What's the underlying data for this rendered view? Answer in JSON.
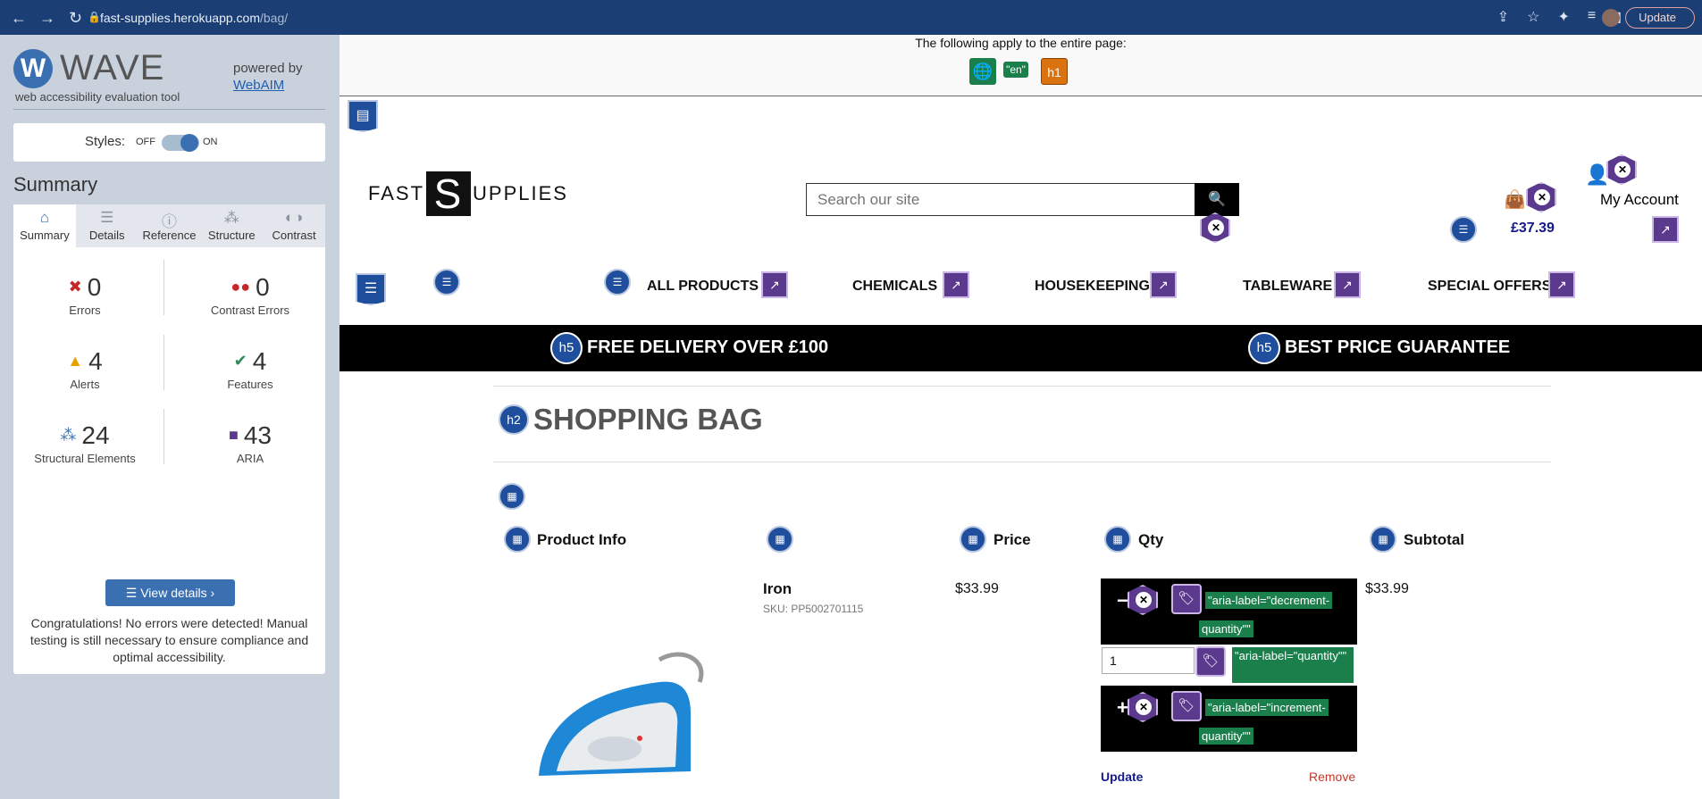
{
  "browser": {
    "url_host": "fast-supplies.herokuapp.com",
    "url_path": "/bag/",
    "update_label": "Update"
  },
  "wave": {
    "logo_text": "WAVE",
    "subtitle": "web accessibility evaluation tool",
    "powered_by": "powered by",
    "webaim_link": "WebAIM",
    "styles_label": "Styles:",
    "styles_off": "OFF",
    "styles_on": "ON",
    "summary_title": "Summary",
    "tabs": [
      {
        "label": "Summary",
        "icon": "home-icon"
      },
      {
        "label": "Details",
        "icon": "list-icon"
      },
      {
        "label": "Reference",
        "icon": "info-icon"
      },
      {
        "label": "Structure",
        "icon": "structure-icon"
      },
      {
        "label": "Contrast",
        "icon": "contrast-icon"
      }
    ],
    "stats": {
      "errors": {
        "value": "0",
        "label": "Errors"
      },
      "contrast_errors": {
        "value": "0",
        "label": "Contrast Errors"
      },
      "alerts": {
        "value": "4",
        "label": "Alerts"
      },
      "features": {
        "value": "4",
        "label": "Features"
      },
      "structural": {
        "value": "24",
        "label": "Structural Elements"
      },
      "aria": {
        "value": "43",
        "label": "ARIA"
      }
    },
    "view_details": "View details ›",
    "congrats": "Congratulations! No errors were detected! Manual testing is still necessary to ensure compliance and optimal accessibility."
  },
  "page": {
    "apply_text": "The following apply to the entire page:",
    "lang_chip": "\"en\"",
    "h1_chip": "h1",
    "logo_left": "FAST",
    "logo_right": "UPPLIES",
    "search_placeholder": "Search our site",
    "bag_amount": "£37.39",
    "account_label": "My Account",
    "menu": [
      "ALL PRODUCTS",
      "CHEMICALS",
      "HOUSEKEEPING",
      "TABLEWARE",
      "SPECIAL OFFERS"
    ],
    "banner_left": "FREE DELIVERY OVER £100",
    "banner_right": "BEST PRICE GUARANTEE",
    "h5": "h5",
    "h2": "h2",
    "bag_title": "SHOPPING BAG",
    "columns": [
      "Product Info",
      "Price",
      "Qty",
      "Subtotal"
    ],
    "product": {
      "name": "Iron",
      "sku": "SKU: PP5002701115",
      "price": "$33.99",
      "qty": "1",
      "subtotal": "$33.99"
    },
    "aria_decrement_1": "\"aria-label=\"decrement-",
    "aria_decrement_2": "quantity\"\"",
    "aria_quantity": "\"aria-label=\"quantity\"\"",
    "aria_increment_1": "\"aria-label=\"increment-",
    "aria_increment_2": "quantity\"\"",
    "update_link": "Update",
    "remove_link": "Remove"
  },
  "colors": {
    "chrome": "#1b3f75",
    "wave_blue": "#3a6fb2",
    "aria_purple": "#5b3a8e",
    "aria_green": "#1a7f4b",
    "brand_navy": "#141a8a"
  }
}
